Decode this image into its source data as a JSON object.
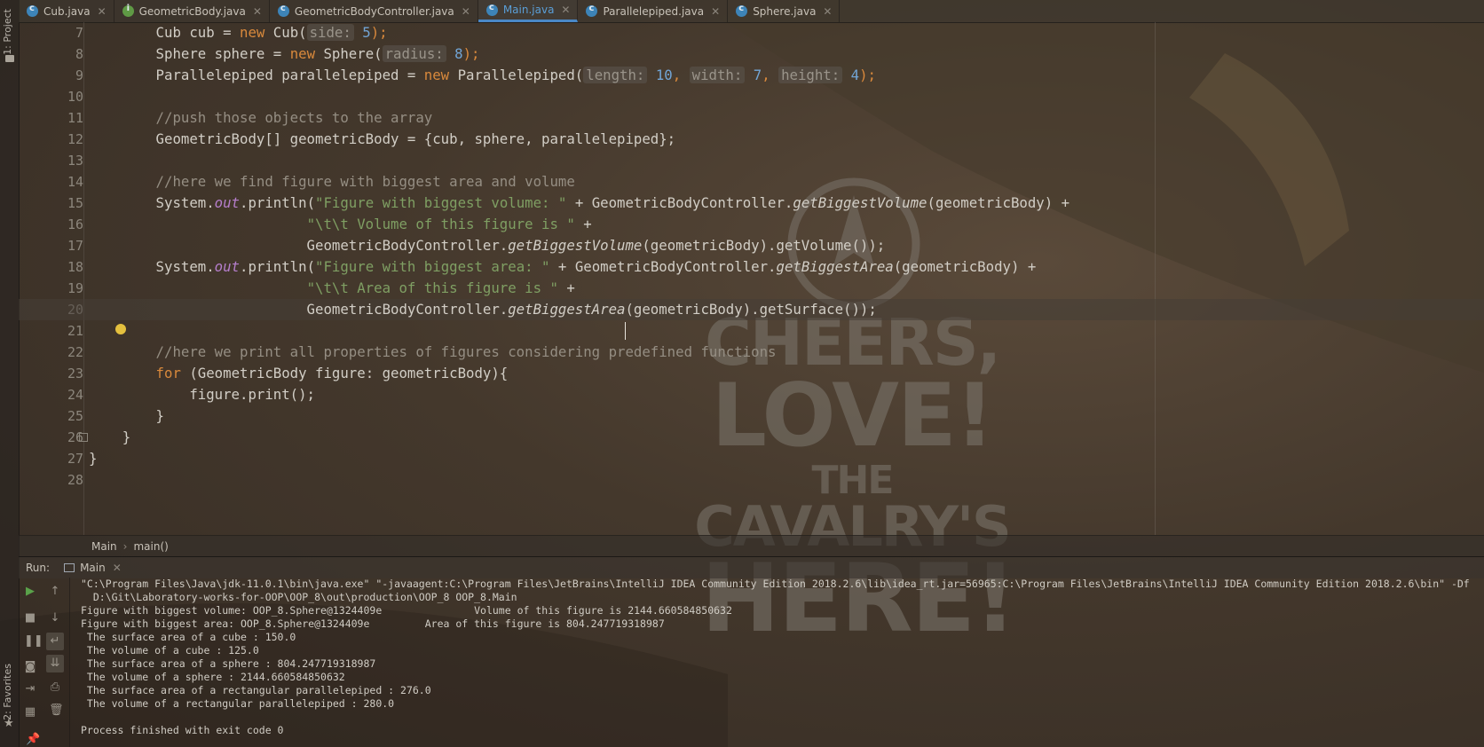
{
  "sidebar": {
    "project_label": "1: Project",
    "favorites_label": "2: Favorites"
  },
  "tabs": [
    {
      "label": "Cub.java",
      "kind": "class"
    },
    {
      "label": "GeometricBody.java",
      "kind": "interface"
    },
    {
      "label": "GeometricBodyController.java",
      "kind": "class"
    },
    {
      "label": "Main.java",
      "kind": "class",
      "active": true
    },
    {
      "label": "Parallelepiped.java",
      "kind": "class"
    },
    {
      "label": "Sphere.java",
      "kind": "class"
    }
  ],
  "editor": {
    "line_numbers": [
      "7",
      "8",
      "9",
      "10",
      "11",
      "12",
      "13",
      "14",
      "15",
      "16",
      "17",
      "18",
      "19",
      "20",
      "21",
      "22",
      "23",
      "24",
      "25",
      "26",
      "27",
      "28"
    ],
    "current_line": "20",
    "lines": {
      "l7": {
        "a": "        Cub cub = ",
        "kw": "new",
        "b": " Cub(",
        "hint": "side:",
        "num": " 5",
        "c": ");"
      },
      "l8": {
        "a": "        Sphere sphere = ",
        "kw": "new",
        "b": " Sphere(",
        "hint": "radius:",
        "num": " 8",
        "c": ");"
      },
      "l9": {
        "a": "        Parallelepiped parallelepiped = ",
        "kw": "new",
        "b": " Parallelepiped(",
        "hint1": "length:",
        "num1": " 10",
        "s1": ", ",
        "hint2": "width:",
        "num2": " 7",
        "s2": ", ",
        "hint3": "height:",
        "num3": " 4",
        "c": ");"
      },
      "l11": "        //push those objects to the array",
      "l12": "        GeometricBody[] geometricBody = {cub, sphere, parallelepiped};",
      "l14": "        //here we find figure with biggest area and volume",
      "l15": {
        "a": "        System.",
        "st": "out",
        "b": ".println(",
        "str": "\"Figure with biggest volume: \"",
        "c": " + GeometricBodyController.",
        "m": "getBiggestVolume",
        "d": "(geometricBody) +"
      },
      "l16": {
        "a": "                          ",
        "str": "\"\\t\\t Volume of this figure is \"",
        "b": " +"
      },
      "l17": {
        "a": "                          GeometricBodyController.",
        "m": "getBiggestVolume",
        "b": "(geometricBody).getVolume());"
      },
      "l18": {
        "a": "        System.",
        "st": "out",
        "b": ".println(",
        "str": "\"Figure with biggest area: \"",
        "c": " + GeometricBodyController.",
        "m": "getBiggestArea",
        "d": "(geometricBody) +"
      },
      "l19": {
        "a": "                          ",
        "str": "\"\\t\\t Area of this figure is \"",
        "b": " +"
      },
      "l20": {
        "a": "                          GeometricBodyController.",
        "m": "getBiggestArea",
        "b": "(geometricBody).getSurface());"
      },
      "l22": "        //here we print all properties of figures considering predefined functions",
      "l23": {
        "kw": "        for",
        "a": " (GeometricBody figure: geometricBody){"
      },
      "l24": "            figure.print();",
      "l25": "        }",
      "l26": "    }",
      "l27": "}"
    }
  },
  "breadcrumb": {
    "class": "Main",
    "method": "main()"
  },
  "run": {
    "label": "Run:",
    "tab_label": "Main",
    "console_lines": [
      "\"C:\\Program Files\\Java\\jdk-11.0.1\\bin\\java.exe\" \"-javaagent:C:\\Program Files\\JetBrains\\IntelliJ IDEA Community Edition 2018.2.6\\lib\\idea_rt.jar=56965:C:\\Program Files\\JetBrains\\IntelliJ IDEA Community Edition 2018.2.6\\bin\" -Df",
      "  D:\\Git\\Laboratory-works-for-OOP\\OOP_8\\out\\production\\OOP_8 OOP_8.Main",
      "Figure with biggest volume: OOP_8.Sphere@1324409e\t\tVolume of this figure is 2144.660584850632",
      "Figure with biggest area: OOP_8.Sphere@1324409e\t\tArea of this figure is 804.247719318987",
      " The surface area of a cube : 150.0",
      " The volume of a cube : 125.0",
      " The surface area of a sphere : 804.247719318987",
      " The volume of a sphere : 2144.660584850632",
      " The surface area of a rectangular parallelepiped : 276.0",
      " The volume of a rectangular parallelepiped : 280.0",
      "",
      "Process finished with exit code 0"
    ]
  },
  "wallpaper": {
    "line1": "CHEERS,",
    "line2": "LOVE!",
    "line3": "THE",
    "line4": "CAVALRY'S",
    "line5": "HERE!"
  },
  "colors": {
    "keyword": "#d9893c",
    "number": "#72a5d6",
    "string": "#7f9f63",
    "comment": "#958e83",
    "static_field": "#b57ecb",
    "active_tab": "#4a88c7"
  }
}
